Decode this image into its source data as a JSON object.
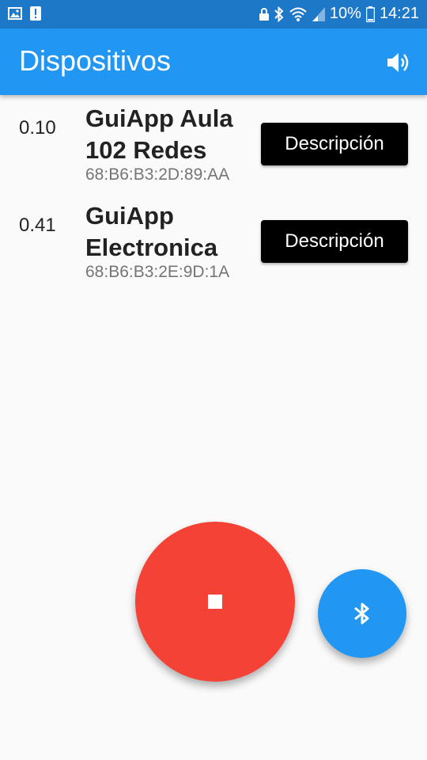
{
  "status_bar": {
    "battery_percent": "10%",
    "time": "14:21",
    "icons": [
      "image-icon",
      "alert-icon",
      "lock-icon",
      "bluetooth-icon",
      "wifi-icon",
      "signal-icon",
      "battery-icon"
    ]
  },
  "app_bar": {
    "title": "Dispositivos",
    "action_icon": "volume-icon"
  },
  "devices": [
    {
      "rssi": "0.10",
      "name": "GuiApp Aula 102 Redes",
      "mac": "68:B6:B3:2D:89:AA",
      "button_label": "Descripción"
    },
    {
      "rssi": "0.41",
      "name": "GuiApp Electronica",
      "mac": "68:B6:B3:2E:9D:1A",
      "button_label": "Descripción"
    }
  ],
  "fabs": {
    "stop_icon": "stop-icon",
    "bluetooth_icon": "bluetooth-icon"
  },
  "colors": {
    "status_bar": "#1e78c8",
    "app_bar": "#2196f3",
    "stop_fab": "#f44336",
    "bluetooth_fab": "#2196f3",
    "button": "#000000",
    "background": "#fafafa"
  }
}
